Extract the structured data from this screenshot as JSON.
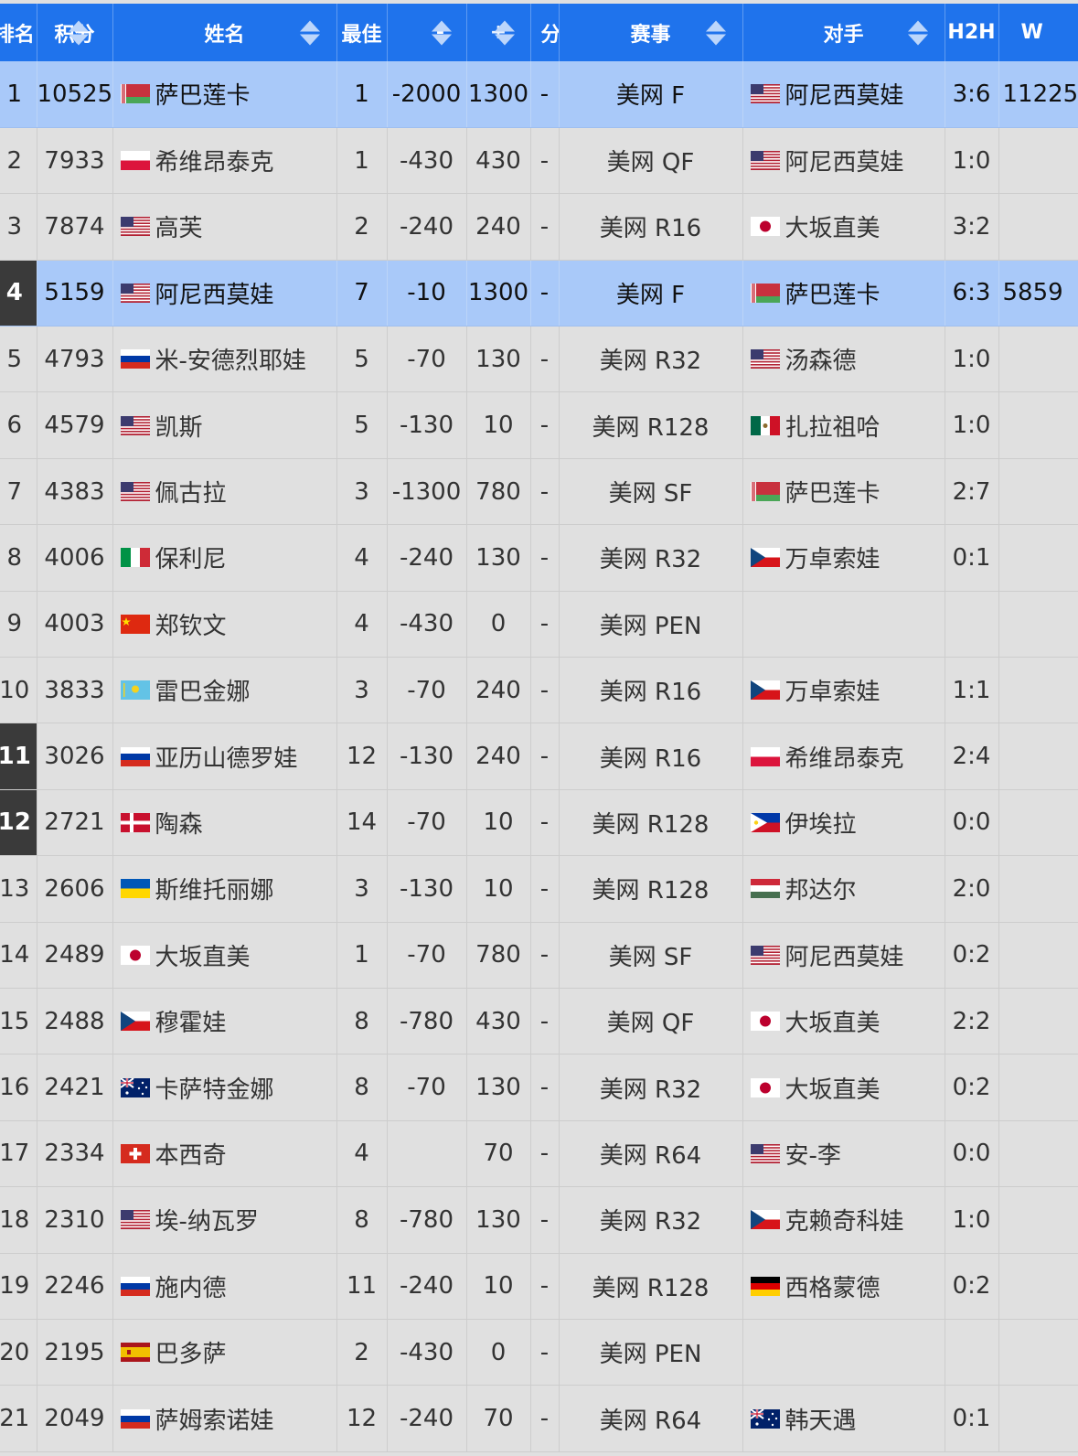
{
  "columns": [
    "排名",
    "积分",
    "姓名",
    "最佳",
    "-",
    "+",
    "分",
    "赛事",
    "对手",
    "H2H",
    "W"
  ],
  "rows": [
    {
      "rank": "1",
      "points": "10525",
      "flag": "BLR",
      "name": "萨巴莲卡",
      "best": "1",
      "minus": "-2000",
      "plus": "1300",
      "fen": "-",
      "event": "美网 F",
      "oppFlag": "USA",
      "opp": "阿尼西莫娃",
      "h2h": "3:6",
      "w": "11225",
      "highlight": true,
      "dark": false
    },
    {
      "rank": "2",
      "points": "7933",
      "flag": "POL",
      "name": "希维昂泰克",
      "best": "1",
      "minus": "-430",
      "plus": "430",
      "fen": "-",
      "event": "美网 QF",
      "oppFlag": "USA",
      "opp": "阿尼西莫娃",
      "h2h": "1:0",
      "w": "",
      "highlight": false,
      "dark": false
    },
    {
      "rank": "3",
      "points": "7874",
      "flag": "USA",
      "name": "高芙",
      "best": "2",
      "minus": "-240",
      "plus": "240",
      "fen": "-",
      "event": "美网 R16",
      "oppFlag": "JPN",
      "opp": "大坂直美",
      "h2h": "3:2",
      "w": "",
      "highlight": false,
      "dark": false
    },
    {
      "rank": "4",
      "points": "5159",
      "flag": "USA",
      "name": "阿尼西莫娃",
      "best": "7",
      "minus": "-10",
      "plus": "1300",
      "fen": "-",
      "event": "美网 F",
      "oppFlag": "BLR",
      "opp": "萨巴莲卡",
      "h2h": "6:3",
      "w": "5859",
      "highlight": true,
      "dark": true
    },
    {
      "rank": "5",
      "points": "4793",
      "flag": "RUS",
      "name": "米-安德烈耶娃",
      "best": "5",
      "minus": "-70",
      "plus": "130",
      "fen": "-",
      "event": "美网 R32",
      "oppFlag": "USA",
      "opp": "汤森德",
      "h2h": "1:0",
      "w": "",
      "highlight": false,
      "dark": false
    },
    {
      "rank": "6",
      "points": "4579",
      "flag": "USA",
      "name": "凯斯",
      "best": "5",
      "minus": "-130",
      "plus": "10",
      "fen": "-",
      "event": "美网 R128",
      "oppFlag": "MEX",
      "opp": "扎拉祖哈",
      "h2h": "1:0",
      "w": "",
      "highlight": false,
      "dark": false
    },
    {
      "rank": "7",
      "points": "4383",
      "flag": "USA",
      "name": "佩古拉",
      "best": "3",
      "minus": "-1300",
      "plus": "780",
      "fen": "-",
      "event": "美网 SF",
      "oppFlag": "BLR",
      "opp": "萨巴莲卡",
      "h2h": "2:7",
      "w": "",
      "highlight": false,
      "dark": false
    },
    {
      "rank": "8",
      "points": "4006",
      "flag": "ITA",
      "name": "保利尼",
      "best": "4",
      "minus": "-240",
      "plus": "130",
      "fen": "-",
      "event": "美网 R32",
      "oppFlag": "CZE",
      "opp": "万卓索娃",
      "h2h": "0:1",
      "w": "",
      "highlight": false,
      "dark": false
    },
    {
      "rank": "9",
      "points": "4003",
      "flag": "CHN",
      "name": "郑钦文",
      "best": "4",
      "minus": "-430",
      "plus": "0",
      "fen": "-",
      "event": "美网 PEN",
      "oppFlag": "",
      "opp": "",
      "h2h": "",
      "w": "",
      "highlight": false,
      "dark": false
    },
    {
      "rank": "10",
      "points": "3833",
      "flag": "KAZ",
      "name": "雷巴金娜",
      "best": "3",
      "minus": "-70",
      "plus": "240",
      "fen": "-",
      "event": "美网 R16",
      "oppFlag": "CZE",
      "opp": "万卓索娃",
      "h2h": "1:1",
      "w": "",
      "highlight": false,
      "dark": false
    },
    {
      "rank": "11",
      "points": "3026",
      "flag": "RUS",
      "name": "亚历山德罗娃",
      "best": "12",
      "minus": "-130",
      "plus": "240",
      "fen": "-",
      "event": "美网 R16",
      "oppFlag": "POL",
      "opp": "希维昂泰克",
      "h2h": "2:4",
      "w": "",
      "highlight": false,
      "dark": true
    },
    {
      "rank": "12",
      "points": "2721",
      "flag": "DEN",
      "name": "陶森",
      "best": "14",
      "minus": "-70",
      "plus": "10",
      "fen": "-",
      "event": "美网 R128",
      "oppFlag": "PHI",
      "opp": "伊埃拉",
      "h2h": "0:0",
      "w": "",
      "highlight": false,
      "dark": true
    },
    {
      "rank": "13",
      "points": "2606",
      "flag": "UKR",
      "name": "斯维托丽娜",
      "best": "3",
      "minus": "-130",
      "plus": "10",
      "fen": "-",
      "event": "美网 R128",
      "oppFlag": "HUN",
      "opp": "邦达尔",
      "h2h": "2:0",
      "w": "",
      "highlight": false,
      "dark": false
    },
    {
      "rank": "14",
      "points": "2489",
      "flag": "JPN",
      "name": "大坂直美",
      "best": "1",
      "minus": "-70",
      "plus": "780",
      "fen": "-",
      "event": "美网 SF",
      "oppFlag": "USA",
      "opp": "阿尼西莫娃",
      "h2h": "0:2",
      "w": "",
      "highlight": false,
      "dark": false
    },
    {
      "rank": "15",
      "points": "2488",
      "flag": "CZE",
      "name": "穆霍娃",
      "best": "8",
      "minus": "-780",
      "plus": "430",
      "fen": "-",
      "event": "美网 QF",
      "oppFlag": "JPN",
      "opp": "大坂直美",
      "h2h": "2:2",
      "w": "",
      "highlight": false,
      "dark": false
    },
    {
      "rank": "16",
      "points": "2421",
      "flag": "AUS",
      "name": "卡萨特金娜",
      "best": "8",
      "minus": "-70",
      "plus": "130",
      "fen": "-",
      "event": "美网 R32",
      "oppFlag": "JPN",
      "opp": "大坂直美",
      "h2h": "0:2",
      "w": "",
      "highlight": false,
      "dark": false
    },
    {
      "rank": "17",
      "points": "2334",
      "flag": "SUI",
      "name": "本西奇",
      "best": "4",
      "minus": "",
      "plus": "70",
      "fen": "-",
      "event": "美网 R64",
      "oppFlag": "USA",
      "opp": "安-李",
      "h2h": "0:0",
      "w": "",
      "highlight": false,
      "dark": false
    },
    {
      "rank": "18",
      "points": "2310",
      "flag": "USA",
      "name": "埃-纳瓦罗",
      "best": "8",
      "minus": "-780",
      "plus": "130",
      "fen": "-",
      "event": "美网 R32",
      "oppFlag": "CZE",
      "opp": "克赖奇科娃",
      "h2h": "1:0",
      "w": "",
      "highlight": false,
      "dark": false
    },
    {
      "rank": "19",
      "points": "2246",
      "flag": "RUS",
      "name": "施内德",
      "best": "11",
      "minus": "-240",
      "plus": "10",
      "fen": "-",
      "event": "美网 R128",
      "oppFlag": "GER",
      "opp": "西格蒙德",
      "h2h": "0:2",
      "w": "",
      "highlight": false,
      "dark": false
    },
    {
      "rank": "20",
      "points": "2195",
      "flag": "ESP",
      "name": "巴多萨",
      "best": "2",
      "minus": "-430",
      "plus": "0",
      "fen": "-",
      "event": "美网 PEN",
      "oppFlag": "",
      "opp": "",
      "h2h": "",
      "w": "",
      "highlight": false,
      "dark": false
    },
    {
      "rank": "21",
      "points": "2049",
      "flag": "RUS",
      "name": "萨姆索诺娃",
      "best": "12",
      "minus": "-240",
      "plus": "70",
      "fen": "-",
      "event": "美网 R64",
      "oppFlag": "AUS",
      "opp": "韩天遇",
      "h2h": "0:1",
      "w": "",
      "highlight": false,
      "dark": false
    }
  ],
  "colors": {
    "header": "#1f73ec",
    "highlight": "#a9c9f9",
    "row": "#e0e0e0",
    "dark_rank": "#3a3a3a"
  }
}
